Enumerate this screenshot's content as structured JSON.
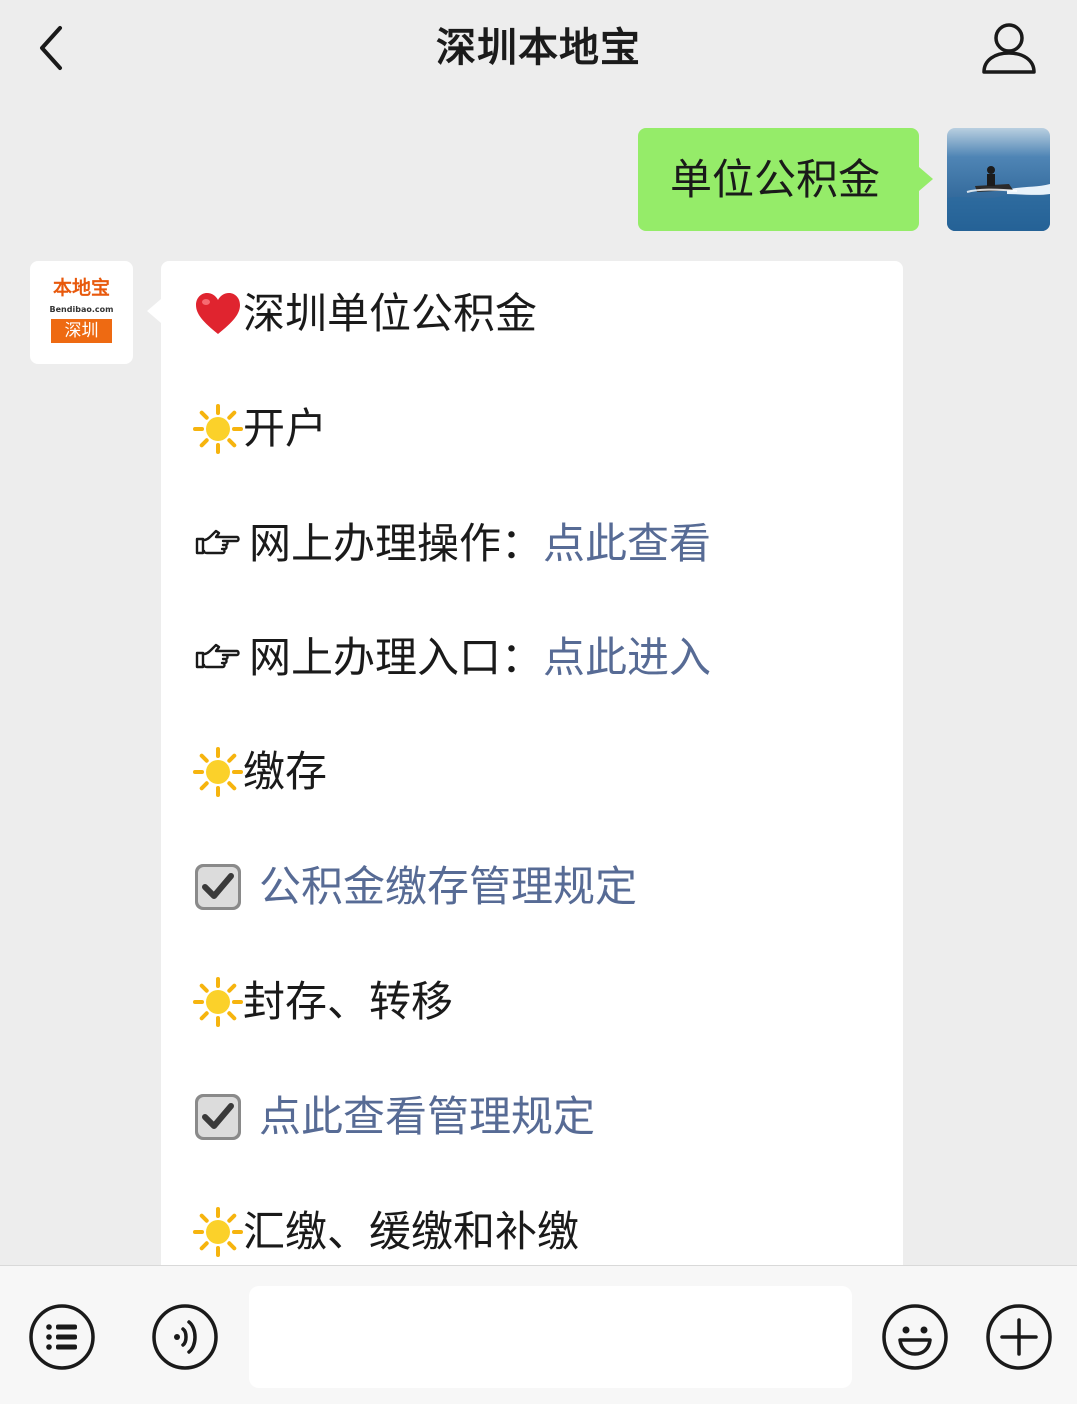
{
  "header": {
    "title": "深圳本地宝"
  },
  "chat": {
    "user_message": {
      "text": "单位公积金"
    },
    "bot": {
      "logo": {
        "brand": "本地宝",
        "site": "Bendibao.com",
        "city": "深圳"
      },
      "rows": [
        {
          "icon": "heart-icon",
          "text": "深圳单位公积金"
        },
        {
          "icon": "sun-icon",
          "text": "开户"
        },
        {
          "icon": "pointing-hand-icon",
          "text": "网上办理操作：",
          "link": "点此查看"
        },
        {
          "icon": "pointing-hand-icon",
          "text": "网上办理入口：",
          "link": "点此进入"
        },
        {
          "icon": "sun-icon",
          "text": "缴存"
        },
        {
          "icon": "checkbox-icon",
          "link": "公积金缴存管理规定"
        },
        {
          "icon": "sun-icon",
          "text": "封存、转移"
        },
        {
          "icon": "checkbox-icon",
          "link": "点此查看管理规定"
        },
        {
          "icon": "sun-icon",
          "text": "汇缴、缓缴和补缴"
        }
      ]
    }
  },
  "footer": {
    "input_value": "",
    "buttons": [
      "menu-list-icon",
      "voice-icon",
      "emoji-icon",
      "plus-icon"
    ]
  },
  "colors": {
    "background": "#ededed",
    "user_bubble": "#95ec69",
    "link": "#576b95",
    "heart": "#e0242f",
    "sun": "#f6b40e",
    "brand_orange": "#ee6a12"
  }
}
